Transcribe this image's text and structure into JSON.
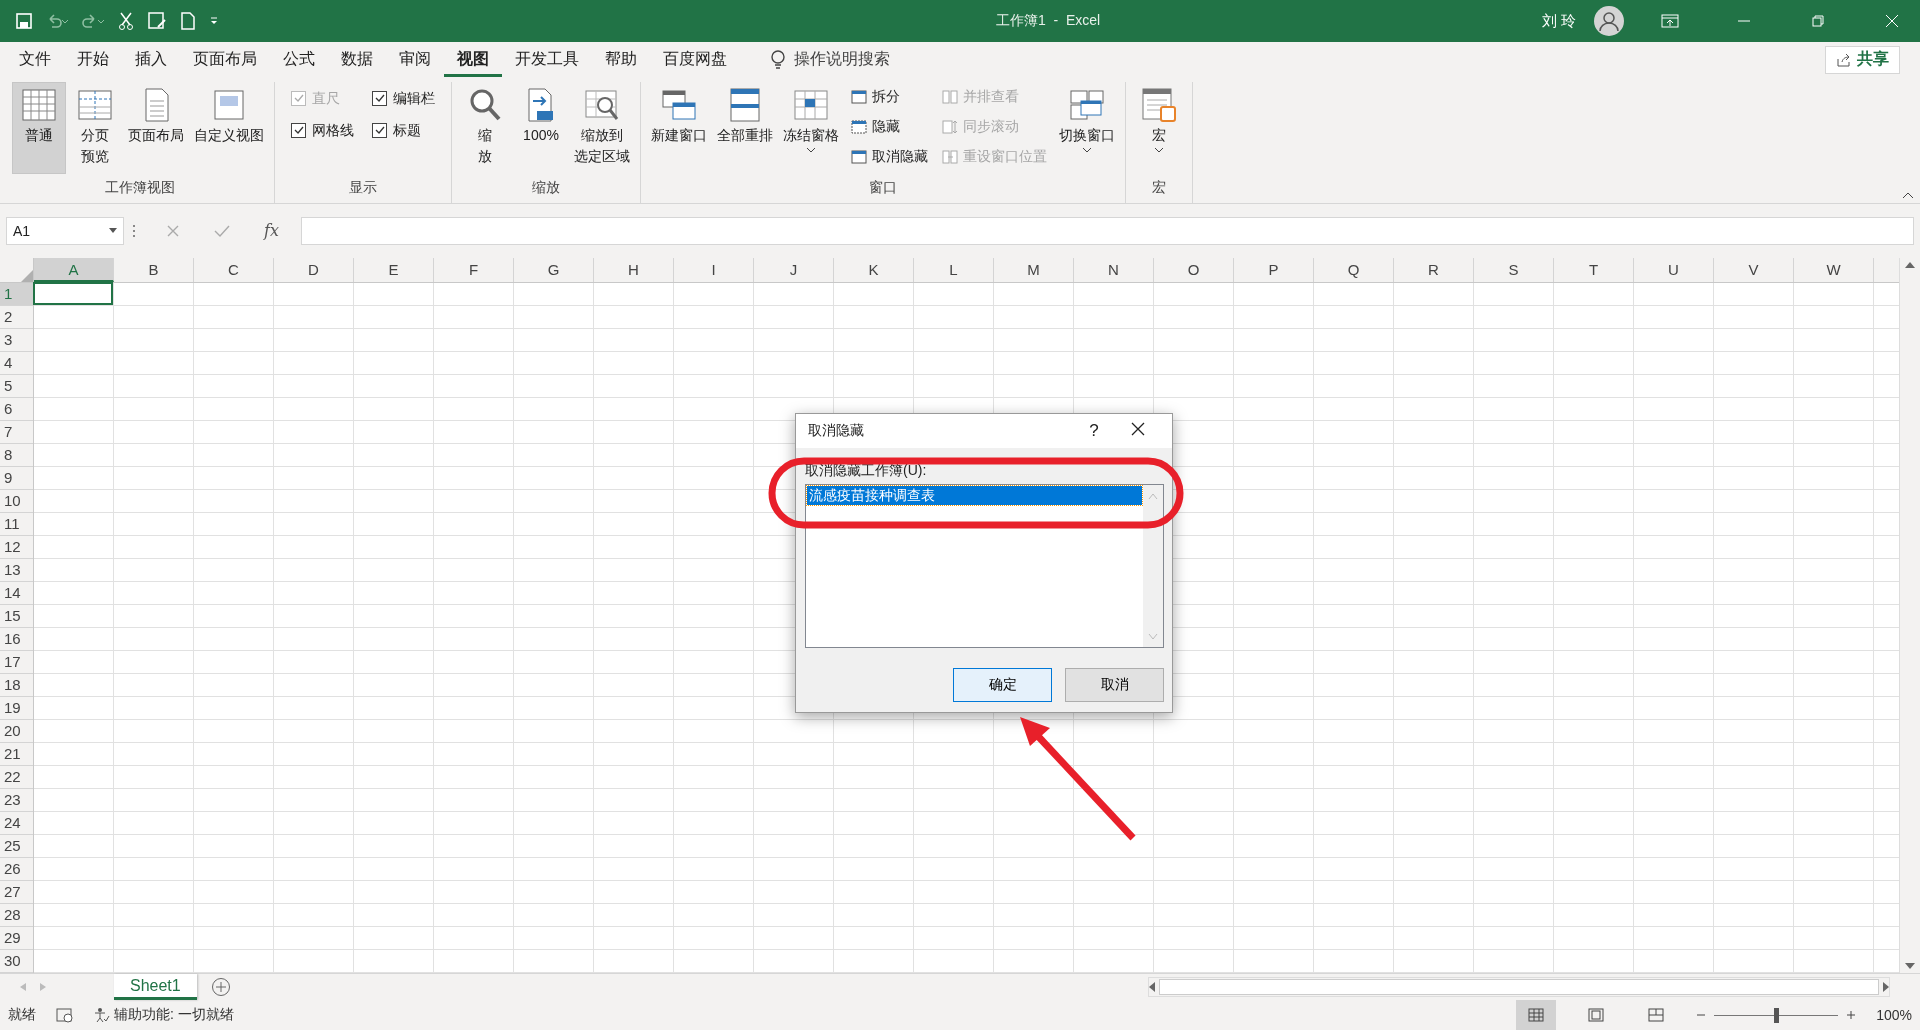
{
  "title_bar": {
    "title": "工作簿1  -  Excel",
    "user": "刘 玲"
  },
  "menu_tabs": [
    {
      "label": "文件",
      "selected": false
    },
    {
      "label": "开始",
      "selected": false
    },
    {
      "label": "插入",
      "selected": false
    },
    {
      "label": "页面布局",
      "selected": false
    },
    {
      "label": "公式",
      "selected": false
    },
    {
      "label": "数据",
      "selected": false
    },
    {
      "label": "审阅",
      "selected": false
    },
    {
      "label": "视图",
      "selected": true
    },
    {
      "label": "开发工具",
      "selected": false
    },
    {
      "label": "帮助",
      "selected": false
    },
    {
      "label": "百度网盘",
      "selected": false
    }
  ],
  "search": {
    "placeholder": "操作说明搜索"
  },
  "share_button": "共享",
  "ribbon": {
    "groups": [
      {
        "label": "工作簿视图",
        "items": [
          {
            "kind": "large",
            "lines": [
              "普通"
            ],
            "selected": true
          },
          {
            "kind": "large",
            "lines": [
              "分页",
              "预览"
            ],
            "selected": false
          },
          {
            "kind": "large",
            "lines": [
              "页面布局"
            ],
            "selected": false
          },
          {
            "kind": "large",
            "lines": [
              "自定义视图"
            ],
            "selected": false
          }
        ]
      },
      {
        "label": "显示",
        "items": [
          {
            "kind": "checkbox",
            "label": "直尺",
            "checked": true,
            "disabled": true
          },
          {
            "kind": "checkbox",
            "label": "编辑栏",
            "checked": true,
            "disabled": false
          },
          {
            "kind": "checkbox",
            "label": "网格线",
            "checked": true,
            "disabled": false
          },
          {
            "kind": "checkbox",
            "label": "标题",
            "checked": true,
            "disabled": false
          }
        ]
      },
      {
        "label": "缩放",
        "items": [
          {
            "kind": "large",
            "lines": [
              "缩",
              "放"
            ],
            "selected": false
          },
          {
            "kind": "large",
            "lines": [
              "100%"
            ],
            "selected": false
          },
          {
            "kind": "large",
            "lines": [
              "缩放到",
              "选定区域"
            ],
            "selected": false
          }
        ]
      },
      {
        "label": "窗口",
        "items": [
          {
            "kind": "large",
            "lines": [
              "新建窗口"
            ],
            "selected": false
          },
          {
            "kind": "large",
            "lines": [
              "全部重排"
            ],
            "selected": false
          },
          {
            "kind": "large",
            "lines": [
              "冻结窗格"
            ],
            "selected": false,
            "dropdown": true
          },
          {
            "kind": "small",
            "label": "拆分",
            "disabled": false
          },
          {
            "kind": "small",
            "label": "隐藏",
            "disabled": false
          },
          {
            "kind": "small",
            "label": "取消隐藏",
            "disabled": false
          },
          {
            "kind": "small",
            "label": "并排查看",
            "disabled": true
          },
          {
            "kind": "small",
            "label": "同步滚动",
            "disabled": true
          },
          {
            "kind": "small",
            "label": "重设窗口位置",
            "disabled": true
          },
          {
            "kind": "large",
            "lines": [
              "切换窗口"
            ],
            "selected": false,
            "dropdown": true
          }
        ]
      },
      {
        "label": "宏",
        "items": [
          {
            "kind": "large",
            "lines": [
              "宏"
            ],
            "selected": false,
            "dropdown": true
          }
        ]
      }
    ]
  },
  "formula_bar": {
    "name_box": "A1",
    "fx": "fx"
  },
  "sheet": {
    "columns": [
      "A",
      "B",
      "C",
      "D",
      "E",
      "F",
      "G",
      "H",
      "I",
      "J",
      "K",
      "L",
      "M",
      "N",
      "O",
      "P",
      "Q",
      "R",
      "S",
      "T",
      "U",
      "V",
      "W"
    ],
    "rows": [
      "1",
      "2",
      "3",
      "4",
      "5",
      "6",
      "7",
      "8",
      "9",
      "10",
      "11",
      "12",
      "13",
      "14",
      "15",
      "16",
      "17",
      "18",
      "19",
      "20",
      "21",
      "22",
      "23",
      "24",
      "25",
      "26",
      "27",
      "28",
      "29",
      "30"
    ]
  },
  "sheet_tabs": [
    {
      "label": "Sheet1",
      "selected": true
    }
  ],
  "status_bar": {
    "ready": "就绪",
    "accessibility": "辅助功能: 一切就绪",
    "zoom": "100%",
    "zoom_slider": {
      "level": 0.5
    },
    "views": [
      {
        "selected": true
      },
      {
        "selected": false
      },
      {
        "selected": false
      }
    ]
  },
  "dialog": {
    "title": "取消隐藏",
    "help": "?",
    "list_label": "取消隐藏工作簿(U):",
    "items": [
      {
        "text": "流感疫苗接种调查表",
        "selected": true
      }
    ],
    "buttons": [
      {
        "label": "确定",
        "default": true
      },
      {
        "label": "取消",
        "default": false
      }
    ]
  }
}
